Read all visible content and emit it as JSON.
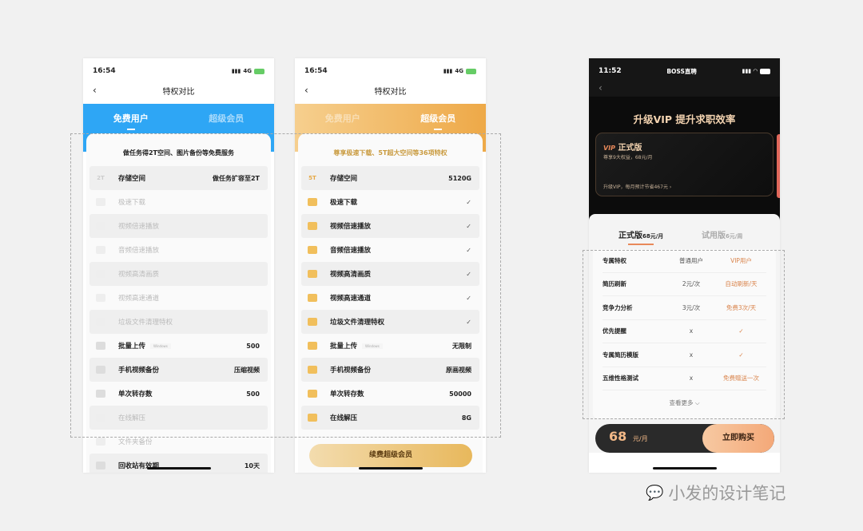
{
  "free": {
    "time": "16:54",
    "network": "4G",
    "title": "特权对比",
    "tabs": [
      "免费用户",
      "超级会员"
    ],
    "subtitle": "做任务得2T空间、图片备份等免费服务",
    "accent": "#2ea6f5",
    "rows": [
      {
        "icon": "2T",
        "label": "存储空间",
        "value": "做任务扩容至2T",
        "on": true
      },
      {
        "label": "极速下载",
        "value": "",
        "on": false
      },
      {
        "label": "视频倍速播放",
        "value": "",
        "on": false
      },
      {
        "label": "音频倍速播放",
        "value": "",
        "on": false
      },
      {
        "label": "视频高清画质",
        "value": "",
        "on": false
      },
      {
        "label": "视频高速通道",
        "value": "",
        "on": false
      },
      {
        "label": "垃圾文件清理特权",
        "value": "",
        "on": false
      },
      {
        "label": "批量上传",
        "tag": "Windows",
        "value": "500",
        "on": true
      },
      {
        "label": "手机视频备份",
        "value": "压缩视频",
        "on": true
      },
      {
        "label": "单次转存数",
        "value": "500",
        "on": true
      },
      {
        "label": "在线解压",
        "value": "",
        "on": false
      },
      {
        "label": "文件夹备份",
        "value": "",
        "on": false
      },
      {
        "label": "回收站有效期",
        "value": "10天",
        "on": true
      }
    ]
  },
  "vip": {
    "time": "16:54",
    "network": "4G",
    "title": "特权对比",
    "tabs": [
      "免费用户",
      "超级会员"
    ],
    "subtitle": "尊享极速下载、5T超大空间等36项特权",
    "accent": "#f0b04e",
    "button": "续费超级会员",
    "rows": [
      {
        "icon": "5T",
        "label": "存储空间",
        "value": "5120G"
      },
      {
        "label": "极速下载",
        "value": "✓"
      },
      {
        "label": "视频倍速播放",
        "value": "✓"
      },
      {
        "label": "音频倍速播放",
        "value": "✓"
      },
      {
        "label": "视频高清画质",
        "value": "✓"
      },
      {
        "label": "视频高速通道",
        "value": "✓"
      },
      {
        "label": "垃圾文件清理特权",
        "value": "✓"
      },
      {
        "label": "批量上传",
        "tag": "Windows",
        "value": "无限制"
      },
      {
        "label": "手机视频备份",
        "value": "原画视频"
      },
      {
        "label": "单次转存数",
        "value": "50000"
      },
      {
        "label": "在线解压",
        "value": "8G"
      }
    ]
  },
  "boss": {
    "time": "11:52",
    "app": "BOSS直聘",
    "headline": "升级VIP 提升求职效率",
    "card": {
      "badge": "VIP",
      "name": "正式版",
      "desc": "尊享9大权益，68元/月",
      "save": "升级VIP，每月预计节省467元 ›"
    },
    "tabs": [
      {
        "name": "正式版",
        "price": "68元/月"
      },
      {
        "name": "试用版",
        "price": "6元/周"
      }
    ],
    "table": [
      [
        "专属特权",
        "普通用户",
        "VIP用户"
      ],
      [
        "简历刷新",
        "2元/次",
        "自动刷新/天"
      ],
      [
        "竞争力分析",
        "3元/次",
        "免费3次/天"
      ],
      [
        "优先提醒",
        "x",
        "✓"
      ],
      [
        "专属简历模版",
        "x",
        "✓"
      ],
      [
        "五维性格测试",
        "x",
        "免费赠送一次"
      ]
    ],
    "more": "查看更多 ⌵",
    "price": "68",
    "unit": "元/月",
    "buy": "立即购买"
  },
  "watermark": "小发的设计笔记"
}
